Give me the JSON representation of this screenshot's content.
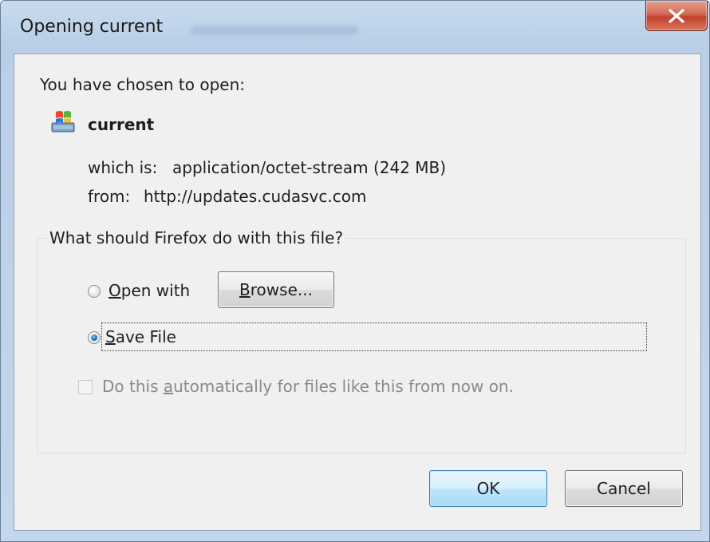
{
  "window": {
    "title": "Opening current",
    "close_label": "x"
  },
  "dialog": {
    "chosen_text": "You have chosen to open:",
    "file_name": "current",
    "which_label": "which is:",
    "which_value": "application/octet-stream (242 MB)",
    "from_label": "from:",
    "from_value": "http://updates.cudasvc.com"
  },
  "action_group": {
    "legend": "What should Firefox do with this file?",
    "open_with": {
      "mnemonic": "O",
      "rest": "pen with",
      "selected": false
    },
    "browse_button": {
      "mnemonic": "B",
      "rest": "rowse..."
    },
    "save_file": {
      "mnemonic": "S",
      "rest": "ave File",
      "selected": true
    },
    "auto_checkbox": {
      "before": "Do this ",
      "mnemonic": "a",
      "after": "utomatically for files like this from now on.",
      "checked": false,
      "enabled": false
    }
  },
  "buttons": {
    "ok": "OK",
    "cancel": "Cancel"
  },
  "colors": {
    "title_bar": "#c3d6ec",
    "client_bg": "#f0f0f0",
    "close_button": "#c2412a",
    "ok_button_border": "#3c7fb1",
    "radio_selected": "#1f6fc6",
    "disabled_text": "#8a8a8a"
  }
}
